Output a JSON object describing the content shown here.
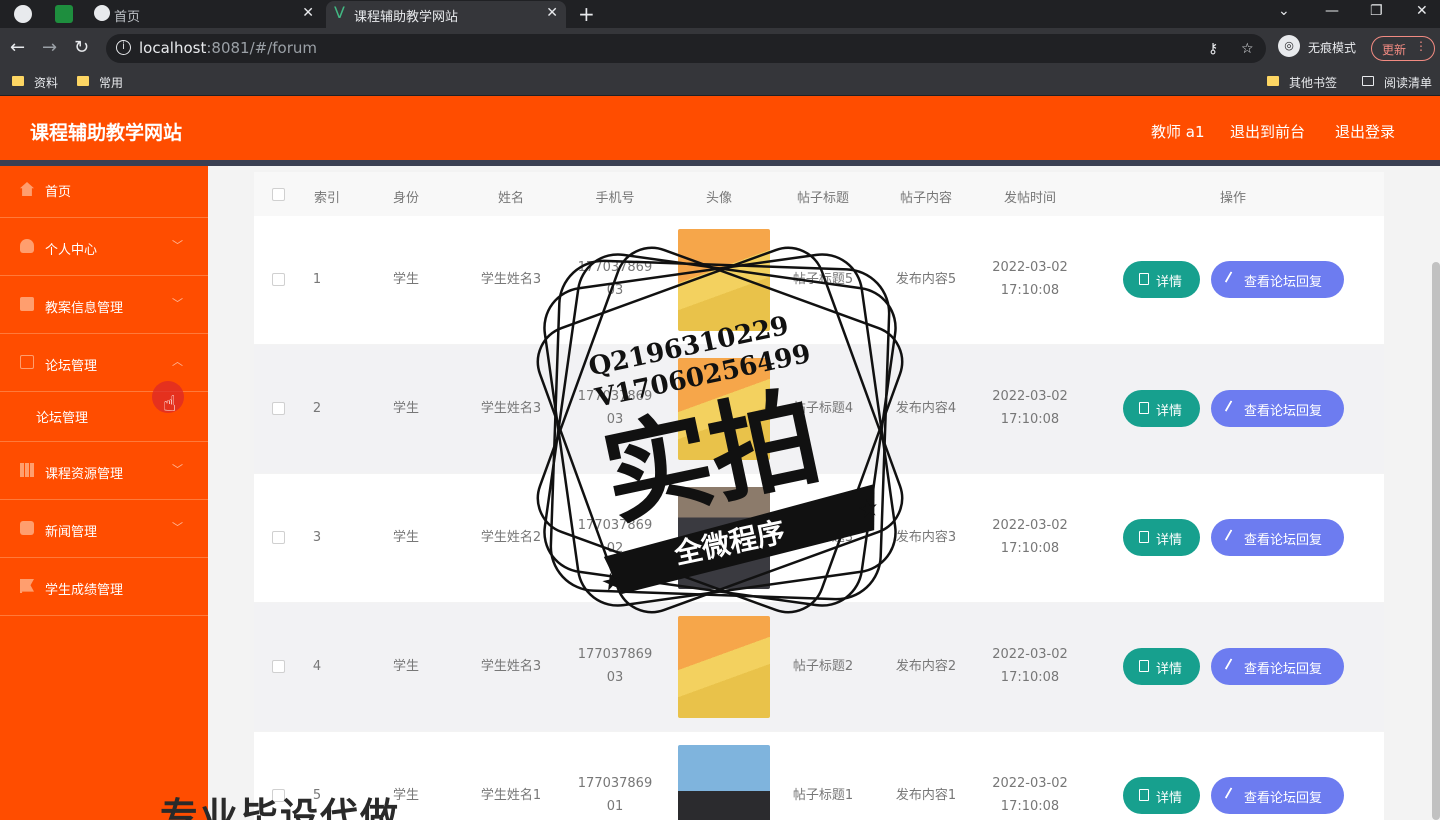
{
  "browser": {
    "tabs": [
      {
        "label": "首页"
      },
      {
        "label": "课程辅助教学网站"
      }
    ],
    "url": {
      "host": "localhost",
      "rest": ":8081/#/forum"
    },
    "incognito_label": "无痕模式",
    "update_label": "更新",
    "bookmarks": {
      "left": [
        "资料",
        "常用"
      ],
      "right": [
        "其他书签",
        "阅读清单"
      ]
    }
  },
  "header": {
    "title": "课程辅助教学网站",
    "user": "教师 a1",
    "to_front": "退出到前台",
    "logout": "退出登录"
  },
  "sidebar": {
    "items": [
      {
        "label": "首页"
      },
      {
        "label": "个人中心"
      },
      {
        "label": "教案信息管理"
      },
      {
        "label": "论坛管理"
      },
      {
        "label": "课程资源管理"
      },
      {
        "label": "新闻管理"
      },
      {
        "label": "学生成绩管理"
      }
    ],
    "submenu": {
      "label": "论坛管理"
    }
  },
  "table": {
    "columns": [
      "索引",
      "身份",
      "姓名",
      "手机号",
      "头像",
      "帖子标题",
      "帖子内容",
      "发帖时间",
      "操作"
    ],
    "rows": [
      {
        "index": "1",
        "role": "学生",
        "name": "学生姓名3",
        "phone1": "177037869",
        "phone2": "03",
        "title": "帖子标题5",
        "content": "发布内容5",
        "date": "2022-03-02",
        "time": "17:10:08"
      },
      {
        "index": "2",
        "role": "学生",
        "name": "学生姓名3",
        "phone1": "177037869",
        "phone2": "03",
        "title": "帖子标题4",
        "content": "发布内容4",
        "date": "2022-03-02",
        "time": "17:10:08"
      },
      {
        "index": "3",
        "role": "学生",
        "name": "学生姓名2",
        "phone1": "177037869",
        "phone2": "02",
        "title": "帖子标题3",
        "content": "发布内容3",
        "date": "2022-03-02",
        "time": "17:10:08"
      },
      {
        "index": "4",
        "role": "学生",
        "name": "学生姓名3",
        "phone1": "177037869",
        "phone2": "03",
        "title": "帖子标题2",
        "content": "发布内容2",
        "date": "2022-03-02",
        "time": "17:10:08"
      },
      {
        "index": "5",
        "role": "学生",
        "name": "学生姓名1",
        "phone1": "177037869",
        "phone2": "01",
        "title": "帖子标题1",
        "content": "发布内容1",
        "date": "2022-03-02",
        "time": "17:10:08"
      }
    ],
    "detail_label": "详情",
    "reply_label": "查看论坛回复"
  },
  "watermark": {
    "q": "Q2196310229",
    "v": "V17060256499",
    "big": "实拍",
    "banner": "全微程序",
    "bottom": "专业毕设代做"
  },
  "colors": {
    "brand": "#ff4d00",
    "detail": "#17a08e",
    "reply": "#6d7cf0"
  }
}
